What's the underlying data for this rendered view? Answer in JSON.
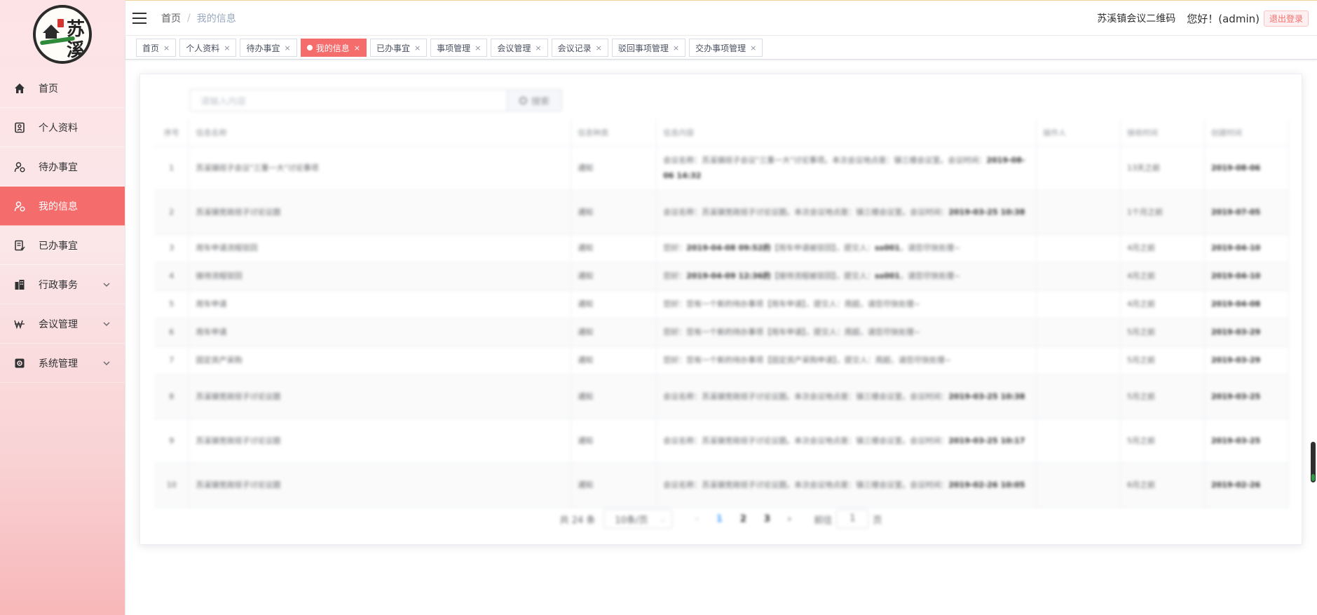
{
  "sidebar": {
    "logo_text": [
      "苏",
      "溪"
    ],
    "items": [
      {
        "label": "首页",
        "icon": "home-icon",
        "active": false,
        "has_children": false
      },
      {
        "label": "个人资料",
        "icon": "profile-icon",
        "active": false,
        "has_children": false
      },
      {
        "label": "待办事宜",
        "icon": "todo-user-icon",
        "active": false,
        "has_children": false
      },
      {
        "label": "我的信息",
        "icon": "user-message-icon",
        "active": true,
        "has_children": false
      },
      {
        "label": "已办事宜",
        "icon": "done-document-icon",
        "active": false,
        "has_children": false
      },
      {
        "label": "行政事务",
        "icon": "building-icon",
        "active": false,
        "has_children": true
      },
      {
        "label": "会议管理",
        "icon": "meeting-icon",
        "active": false,
        "has_children": true
      },
      {
        "label": "系统管理",
        "icon": "settings-box-icon",
        "active": false,
        "has_children": true
      }
    ]
  },
  "header": {
    "breadcrumb": [
      "首页",
      "我的信息"
    ],
    "separator": "/",
    "qr_link": "苏溪镇会议二维码",
    "greeting": "您好！(admin)",
    "logout": "退出登录"
  },
  "tags": [
    {
      "label": "首页",
      "active": false
    },
    {
      "label": "个人资料",
      "active": false
    },
    {
      "label": "待办事宜",
      "active": false
    },
    {
      "label": "我的信息",
      "active": true
    },
    {
      "label": "已办事宜",
      "active": false
    },
    {
      "label": "事项管理",
      "active": false
    },
    {
      "label": "会议管理",
      "active": false
    },
    {
      "label": "会议记录",
      "active": false
    },
    {
      "label": "驳回事项管理",
      "active": false
    },
    {
      "label": "交办事项管理",
      "active": false
    }
  ],
  "search": {
    "placeholder": "请输入内容",
    "button": "搜索"
  },
  "table": {
    "columns": [
      "序号",
      "信息名称",
      "信息种类",
      "信息内容",
      "操作人",
      "接收时间",
      "创建时间"
    ],
    "rows": [
      {
        "no": "1",
        "name": "苏溪镇班子会议\"三重一大\"讨论事项",
        "type": "通知",
        "content": [
          "会议名称：苏溪镇班子会议\"三重一大\"讨论事项。本次会议地点是：镇三楼会议室。会议时间：",
          "2019-08-06 14:32"
        ],
        "operator": "",
        "received": "13天之前",
        "created": "2019-08-06"
      },
      {
        "no": "2",
        "name": "苏溪镇党政班子讨论议题",
        "type": "通知",
        "content": [
          "会议名称：苏溪镇党政班子讨论议题。本次会议地点是：镇三楼会议室。会议时间：",
          "2019-03-25 10:38"
        ],
        "operator": "",
        "received": "1个月之前",
        "created": "2019-07-05"
      },
      {
        "no": "3",
        "name": "用车申请流程驳回",
        "type": "通知",
        "content": [
          "您好：",
          "2019-04-08 09:52的",
          "【用车申请被驳回】，提交人：",
          "ss001",
          "，请您尽快处理~"
        ],
        "operator": "",
        "received": "4月之前",
        "created": "2019-04-10"
      },
      {
        "no": "4",
        "name": "接待流程驳回",
        "type": "通知",
        "content": [
          "您好：",
          "2019-04-09 12:36的",
          "【接待流程被驳回】，提交人：",
          "ss001",
          "，请您尽快处理~"
        ],
        "operator": "",
        "received": "4月之前",
        "created": "2019-04-10"
      },
      {
        "no": "5",
        "name": "用车申请",
        "type": "通知",
        "content": [
          "您好：您有一个新的待办事项【用车申请】，提交人：周超，请您尽快处理~"
        ],
        "operator": "",
        "received": "4月之前",
        "created": "2019-04-08"
      },
      {
        "no": "6",
        "name": "用车申请",
        "type": "通知",
        "content": [
          "您好：您有一个新的待办事项【用车申请】，提交人：周超，请您尽快处理~"
        ],
        "operator": "",
        "received": "5月之前",
        "created": "2019-03-29"
      },
      {
        "no": "7",
        "name": "固定资产采购",
        "type": "通知",
        "content": [
          "您好：您有一个新的待办事项【固定资产采购申请】，提交人：周超，请您尽快处理~"
        ],
        "operator": "",
        "received": "5月之前",
        "created": "2019-03-29"
      },
      {
        "no": "8",
        "name": "苏溪镇党政班子讨论议题",
        "type": "通知",
        "content": [
          "会议名称：苏溪镇党政班子讨论议题。本次会议地点是：镇三楼会议室。会议时间：",
          "2019-03-25 10:38"
        ],
        "operator": "",
        "received": "5月之前",
        "created": "2019-03-25"
      },
      {
        "no": "9",
        "name": "苏溪镇党政班子讨论议题",
        "type": "通知",
        "content": [
          "会议名称：苏溪镇党政班子讨论议题。本次会议地点是：镇三楼会议室。会议时间：",
          "2019-03-25 10:17"
        ],
        "operator": "",
        "received": "5月之前",
        "created": "2019-03-25"
      },
      {
        "no": "10",
        "name": "苏溪镇党政班子讨论议题",
        "type": "通知",
        "content": [
          "会议名称：苏溪镇党政班子讨论议题。本次会议地点是：镇三楼会议室。会议时间：",
          "2019-02-26 10:05"
        ],
        "operator": "",
        "received": "6月之前",
        "created": "2019-02-26"
      }
    ]
  },
  "pagination": {
    "total": "共 24 条",
    "page_size": "10条/页",
    "pages": [
      "1",
      "2",
      "3"
    ],
    "current": "1",
    "jump_prefix": "前往",
    "jump_value": "1",
    "jump_suffix": "页"
  }
}
